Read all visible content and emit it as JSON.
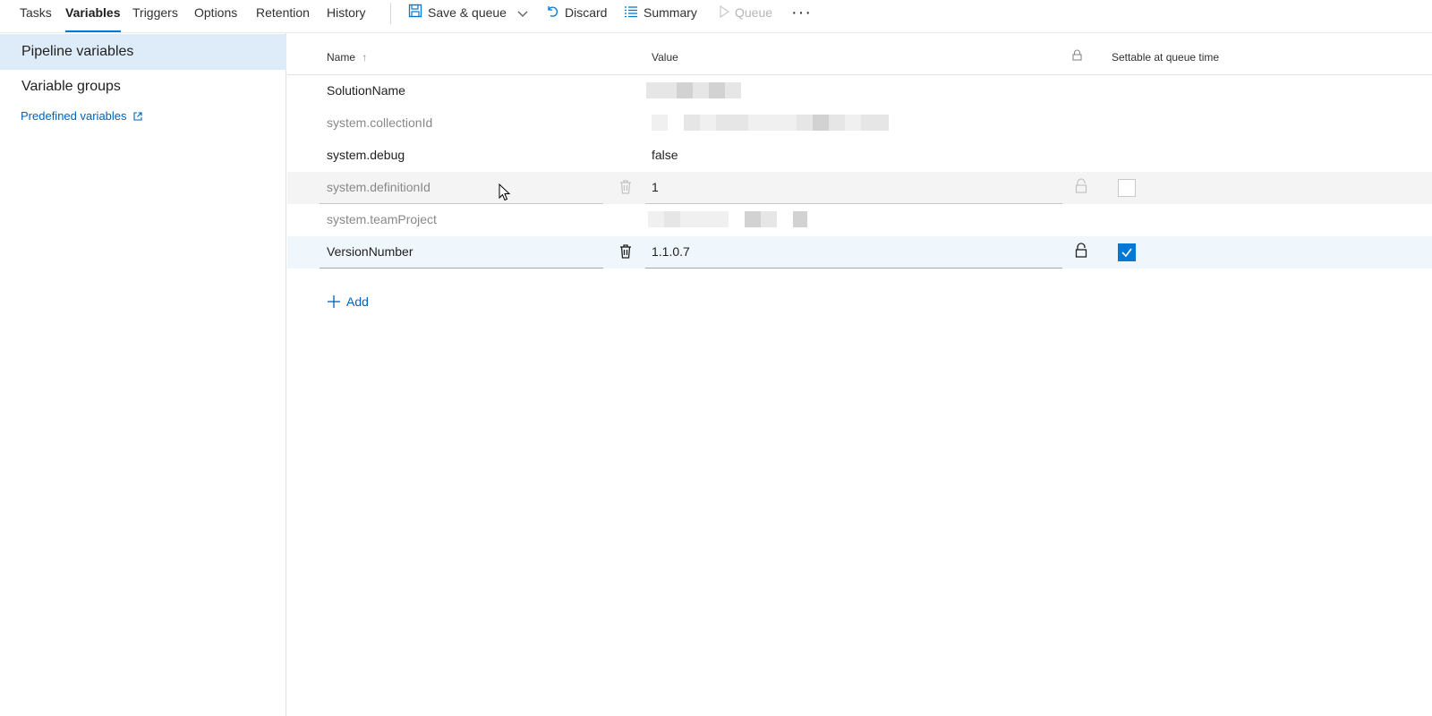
{
  "tabs": [
    {
      "label": "Tasks"
    },
    {
      "label": "Variables"
    },
    {
      "label": "Triggers"
    },
    {
      "label": "Options"
    },
    {
      "label": "Retention"
    },
    {
      "label": "History"
    }
  ],
  "commands": {
    "save_queue": "Save & queue",
    "discard": "Discard",
    "summary": "Summary",
    "queue": "Queue",
    "more": "···"
  },
  "sidebar": {
    "items": [
      {
        "label": "Pipeline variables"
      },
      {
        "label": "Variable groups"
      }
    ],
    "predefined_link": "Predefined variables"
  },
  "grid": {
    "headers": {
      "name": "Name",
      "sort_indicator": "↑",
      "value": "Value",
      "settable": "Settable at queue time"
    },
    "rows": [
      {
        "name": "SolutionName",
        "value": ""
      },
      {
        "name": "system.collectionId",
        "value": ""
      },
      {
        "name": "system.debug",
        "value": "false"
      },
      {
        "name": "system.definitionId",
        "value": "1",
        "settable": false
      },
      {
        "name": "system.teamProject",
        "value": ""
      },
      {
        "name": "VersionNumber",
        "value": "1.1.0.7",
        "settable": true
      }
    ],
    "add_label": "Add"
  },
  "colors": {
    "accent": "#0078d4",
    "selected_nav": "#deecf9",
    "link": "#0062b8"
  }
}
